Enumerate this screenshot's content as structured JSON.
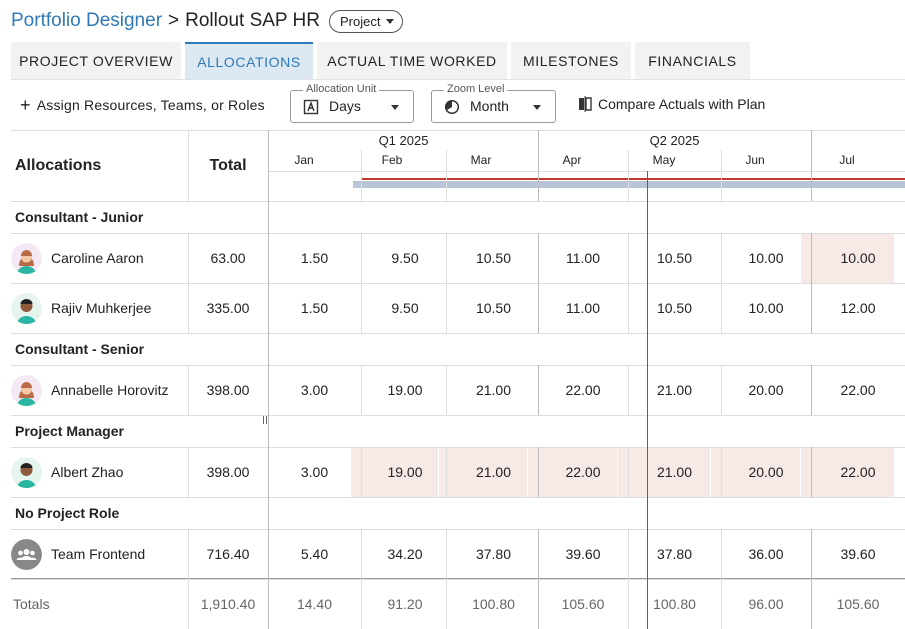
{
  "breadcrumb": {
    "root": "Portfolio Designer",
    "separator": ">",
    "title": "Rollout SAP HR",
    "type_pill": "Project"
  },
  "tabs": [
    {
      "label": "PROJECT OVERVIEW",
      "active": false
    },
    {
      "label": "ALLOCATIONS",
      "active": true
    },
    {
      "label": "ACTUAL TIME WORKED",
      "active": false
    },
    {
      "label": "MILESTONES",
      "active": false
    },
    {
      "label": "FINANCIALS",
      "active": false
    }
  ],
  "toolbar": {
    "add_label": "Assign Resources, Teams, or Roles",
    "allocation_unit": {
      "legend": "Allocation Unit",
      "value": "Days",
      "icon": "letter-a-box-icon"
    },
    "zoom_level": {
      "legend": "Zoom Level",
      "value": "Month",
      "icon": "clock-pie-icon"
    },
    "compare_label": "Compare Actuals with Plan"
  },
  "grid": {
    "col_allocations": "Allocations",
    "col_total": "Total",
    "quarters": [
      "Q1 2025",
      "Q2 2025"
    ],
    "months": [
      "Jan",
      "Feb",
      "Mar",
      "Apr",
      "May",
      "Jun",
      "Jul"
    ],
    "groups": [
      {
        "name": "Consultant - Junior",
        "rows": [
          {
            "name": "Caroline Aaron",
            "avatar": "woman-avatar",
            "total": "63.00",
            "values": [
              "1.50",
              "9.50",
              "10.50",
              "11.00",
              "10.50",
              "10.00",
              "10.00"
            ],
            "highlight": [
              false,
              false,
              false,
              false,
              false,
              false,
              true
            ]
          },
          {
            "name": "Rajiv Muhkerjee",
            "avatar": "man-avatar",
            "total": "335.00",
            "values": [
              "1.50",
              "9.50",
              "10.50",
              "11.00",
              "10.50",
              "10.00",
              "12.00"
            ],
            "highlight": [
              false,
              false,
              false,
              false,
              false,
              false,
              false
            ]
          }
        ]
      },
      {
        "name": "Consultant - Senior",
        "rows": [
          {
            "name": "Annabelle Horovitz",
            "avatar": "woman-avatar",
            "total": "398.00",
            "values": [
              "3.00",
              "19.00",
              "21.00",
              "22.00",
              "21.00",
              "20.00",
              "22.00"
            ],
            "highlight": [
              false,
              false,
              false,
              false,
              false,
              false,
              false
            ]
          }
        ]
      },
      {
        "name": "Project Manager",
        "rows": [
          {
            "name": "Albert Zhao",
            "avatar": "man-avatar",
            "total": "398.00",
            "values": [
              "3.00",
              "19.00",
              "21.00",
              "22.00",
              "21.00",
              "20.00",
              "22.00"
            ],
            "highlight": [
              false,
              true,
              true,
              true,
              true,
              true,
              true
            ]
          }
        ]
      },
      {
        "name": "No Project Role",
        "rows": [
          {
            "name": "Team Frontend",
            "avatar": "team-icon",
            "total": "716.40",
            "values": [
              "5.40",
              "34.20",
              "37.80",
              "39.60",
              "37.80",
              "36.00",
              "39.60"
            ],
            "highlight": [
              false,
              false,
              false,
              false,
              false,
              false,
              false
            ]
          }
        ]
      }
    ],
    "totals": {
      "label": "Totals",
      "total": "1,910.40",
      "values": [
        "14.40",
        "91.20",
        "100.80",
        "105.60",
        "100.80",
        "96.00",
        "105.60"
      ]
    }
  },
  "colors": {
    "accent": "#2f7ab8",
    "today_line": "#c0392b",
    "timeline_bar": "#b7c5d6",
    "overallocated": "#f6e9e6"
  }
}
